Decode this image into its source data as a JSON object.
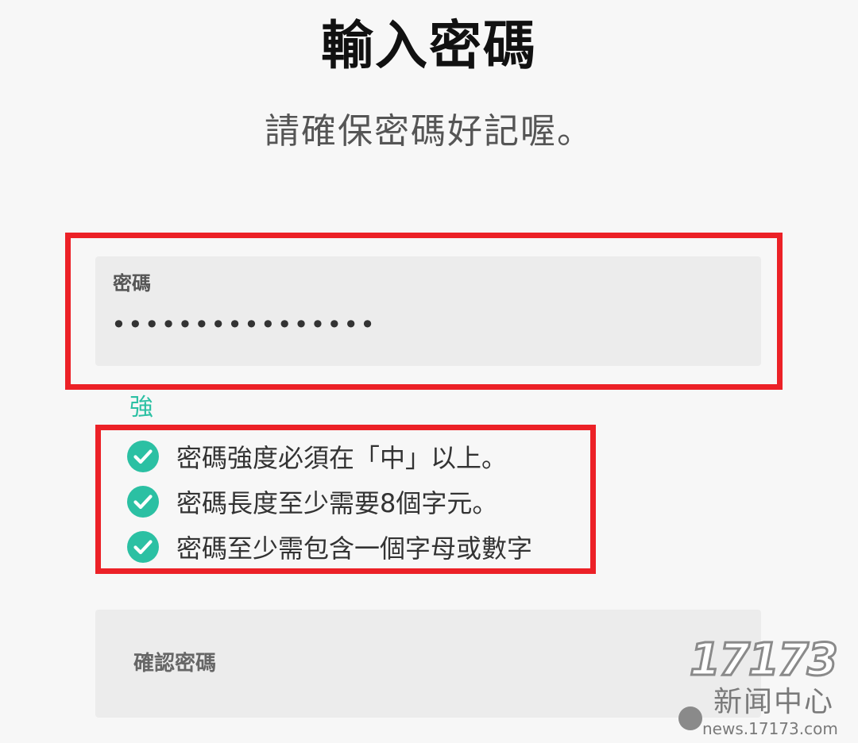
{
  "header": {
    "title": "輸入密碼",
    "subtitle": "請確保密碼好記喔。"
  },
  "password_field": {
    "label": "密碼",
    "value": "••••••••••••••••"
  },
  "strength": {
    "label": "強",
    "color": "#2bc0a3"
  },
  "rules": [
    {
      "text": "密碼強度必須在「中」以上。",
      "icon": "check-circle-icon",
      "met": true
    },
    {
      "text": "密碼長度至少需要8個字元。",
      "icon": "check-circle-icon",
      "met": true
    },
    {
      "text": "密碼至少需包含一個字母或數字",
      "icon": "check-circle-icon",
      "met": true
    }
  ],
  "confirm_field": {
    "label": "確認密碼",
    "value": ""
  },
  "watermark": {
    "digits": "17173",
    "text": "新闻中心",
    "url": "news.17173.com"
  },
  "colors": {
    "highlight": "#ec2127",
    "accent": "#2bc0a3",
    "field_background": "#ececec"
  }
}
